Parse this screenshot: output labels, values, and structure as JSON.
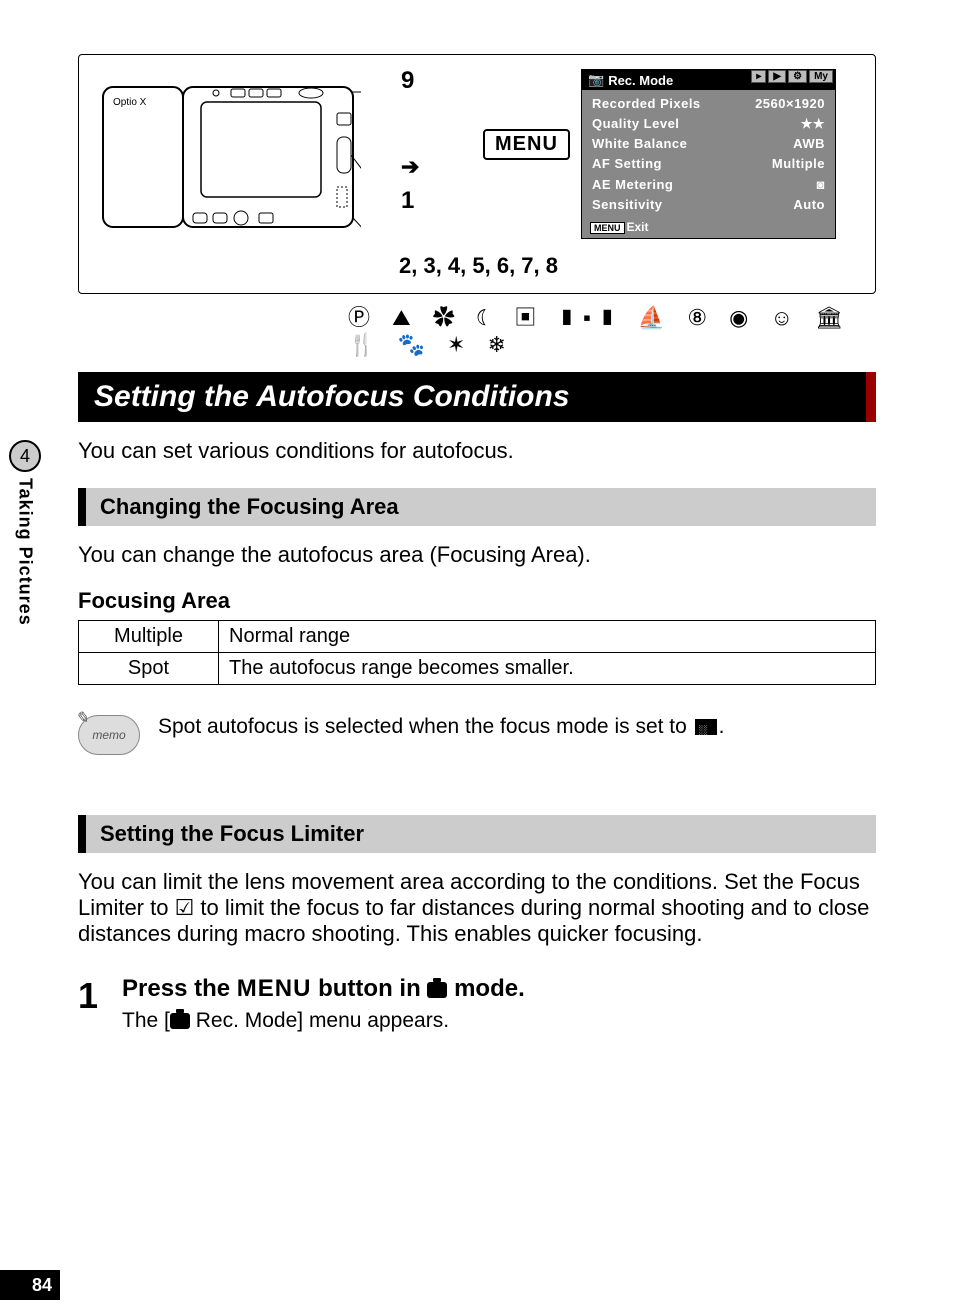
{
  "side": {
    "chapter_number": "4",
    "chapter_label": "Taking Pictures"
  },
  "page_number": "84",
  "diagram": {
    "callout_top": "9",
    "callout_mid": "1",
    "callout_bottom": "2, 3, 4, 5, 6, 7, 8",
    "menu_label": "MENU",
    "arrow": "➔"
  },
  "screen": {
    "header_icon": "📷",
    "header": "Rec. Mode",
    "tabs": [
      "▸",
      "▶",
      "⚙",
      "My"
    ],
    "rows": [
      {
        "k": "Recorded Pixels",
        "v": "2560×1920"
      },
      {
        "k": "Quality Level",
        "v": "★★"
      },
      {
        "k": "White Balance",
        "v": "AWB"
      },
      {
        "k": "AF Setting",
        "v": "Multiple"
      },
      {
        "k": "AE Metering",
        "v": "◙"
      },
      {
        "k": "Sensitivity",
        "v": "Auto"
      }
    ],
    "exit_button": "MENU",
    "exit_label": "Exit"
  },
  "mode_icons": "Ⓟ ⛰ ✿ ☾ ▣ ▮▪▮ ⛵ ⑧ ◉ ☺ 🏛 🍴 🐾 ✶ ❄",
  "section_title": "Setting the Autofocus Conditions",
  "intro_text": "You can set various conditions for autofocus.",
  "sub1_title": "Changing the Focusing Area",
  "sub1_text": "You can change the autofocus area (Focusing Area).",
  "table_caption": "Focusing Area",
  "table": [
    {
      "k": "Multiple",
      "v": "Normal range"
    },
    {
      "k": "Spot",
      "v": "The autofocus range becomes smaller."
    }
  ],
  "memo_label": "memo",
  "memo_text_a": "Spot autofocus is selected when the focus mode is set to ",
  "memo_text_b": ".",
  "sub2_title": "Setting the Focus Limiter",
  "sub2_text": "You can limit the lens movement area according to the conditions. Set the Focus Limiter to ☑ to limit the focus to far distances during normal shooting and to close distances during macro shooting. This enables quicker focusing.",
  "step": {
    "num": "1",
    "title_a": "Press the ",
    "menu_word": "MENU",
    "title_b": " button in ",
    "title_c": " mode.",
    "sub_a": "The [",
    "sub_b": " Rec. Mode] menu appears."
  }
}
